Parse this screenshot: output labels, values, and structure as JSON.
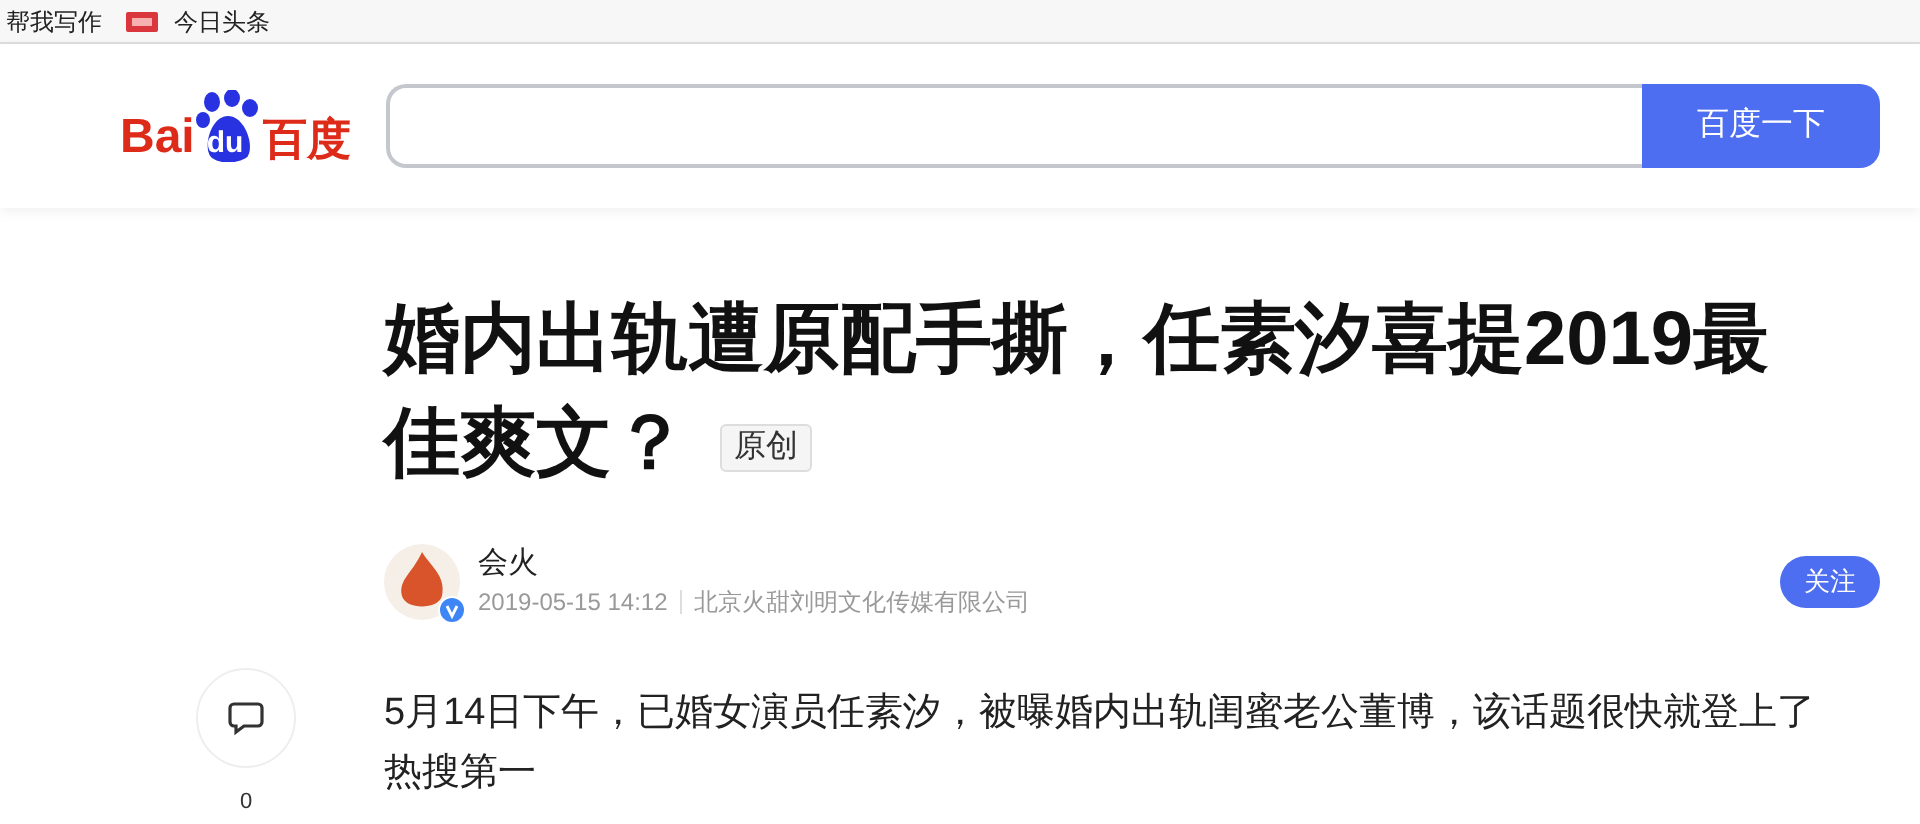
{
  "bookmarks_bar": {
    "items": [
      {
        "label": "帮我写作",
        "icon": false
      },
      {
        "label": "今日头条",
        "icon": true
      }
    ]
  },
  "header": {
    "logo": {
      "left": "Bai",
      "paw": "du",
      "right": "百度"
    },
    "search": {
      "button": "百度一下"
    }
  },
  "article": {
    "title": "婚内出轨遭原配手撕，任素汐喜提2019最佳爽文？",
    "tag": "原创",
    "author": {
      "name": "会火",
      "verified": true,
      "time": "2019-05-15 14:12",
      "company": "北京火甜刘明文化传媒有限公司",
      "follow": "关注"
    },
    "comments": {
      "count": "0"
    },
    "paragraph": "5月14日下午，已婚女演员任素汐，被曝婚内出轨闺蜜老公董博，该话题很快就登上了热搜第一"
  }
}
